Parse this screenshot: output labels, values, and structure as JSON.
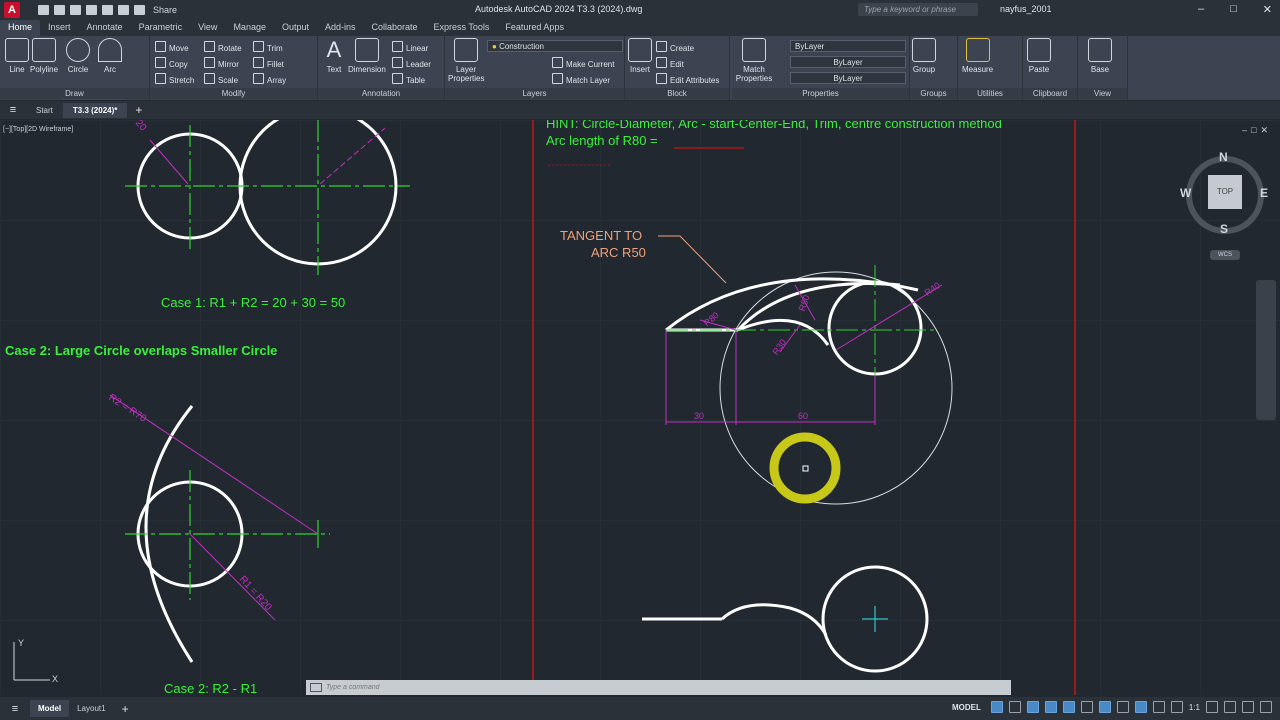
{
  "titlebar": {
    "logo": "A",
    "share": "Share",
    "title": "Autodesk AutoCAD 2024    T3.3 (2024).dwg",
    "search_placeholder": "Type a keyword or phrase",
    "user": "nayfus_2001"
  },
  "tabs": [
    "Home",
    "Insert",
    "Annotate",
    "Parametric",
    "View",
    "Manage",
    "Output",
    "Add-ins",
    "Collaborate",
    "Express Tools",
    "Featured Apps"
  ],
  "ribbon": {
    "draw": {
      "title": "Draw",
      "line": "Line",
      "polyline": "Polyline",
      "circle": "Circle",
      "arc": "Arc"
    },
    "modify": {
      "title": "Modify",
      "move": "Move",
      "rotate": "Rotate",
      "trim": "Trim",
      "copy": "Copy",
      "mirror": "Mirror",
      "fillet": "Fillet",
      "stretch": "Stretch",
      "scale": "Scale",
      "array": "Array"
    },
    "annotation": {
      "title": "Annotation",
      "text": "Text",
      "dimension": "Dimension",
      "linear": "Linear",
      "leader": "Leader",
      "table": "Table"
    },
    "layers": {
      "title": "Layers",
      "layer_properties": "Layer Properties",
      "current_layer": "Construction",
      "make_current": "Make Current",
      "match_layer": "Match Layer"
    },
    "block": {
      "title": "Block",
      "insert": "Insert",
      "create": "Create",
      "edit": "Edit",
      "edit_attributes": "Edit Attributes"
    },
    "properties": {
      "title": "Properties",
      "match_properties": "Match Properties",
      "color": "ByLayer",
      "linetype": "ByLayer",
      "lineweight": "ByLayer"
    },
    "groups": {
      "title": "Groups",
      "group": "Group"
    },
    "utilities": {
      "title": "Utilities",
      "measure": "Measure"
    },
    "clipboard": {
      "title": "Clipboard",
      "paste": "Paste"
    },
    "view": {
      "title": "View",
      "base": "Base"
    }
  },
  "filetabs": {
    "start": "Start",
    "active": "T3.3 (2024)*"
  },
  "viewport_label": "[−][Top][2D Wireframe]",
  "drawing": {
    "hint": "HINT: Circle-Diameter, Arc - start-Center-End, Trim, centre construction method",
    "arc_length": "Arc length of R80 = ",
    "tangent_line1": "TANGENT TO",
    "tangent_line2": "ARC R50",
    "case1": "Case 1: R1 + R2 = 20 + 30 = 50",
    "case2_heading": "Case 2: Large Circle overlaps Smaller Circle",
    "case2_formula": "Case 2: R2 - R1",
    "dim_r2_r70": "R2 = R70",
    "dim_r1_r20": "R1 = R20",
    "dim_20": "20",
    "dim_r80": "R80",
    "dim_r50": "R50",
    "dim_r30": "R30",
    "dim_r40": "R40",
    "dim_30": "30",
    "dim_60": "60"
  },
  "viewcube": {
    "n": "N",
    "s": "S",
    "e": "E",
    "w": "W",
    "top": "TOP",
    "wcs": "WCS"
  },
  "ucs": {
    "x": "X",
    "y": "Y"
  },
  "command": {
    "placeholder": "Type a command"
  },
  "statusbar": {
    "model_tab": "Model",
    "layout_tab": "Layout1",
    "model_label": "MODEL",
    "scale": "1:1"
  },
  "colors": {
    "accent": "#3cf03c",
    "dimension": "#c030c0",
    "centerline": "#2ed42e",
    "border": "#c81414",
    "cursor_ring": "#c8c818"
  }
}
